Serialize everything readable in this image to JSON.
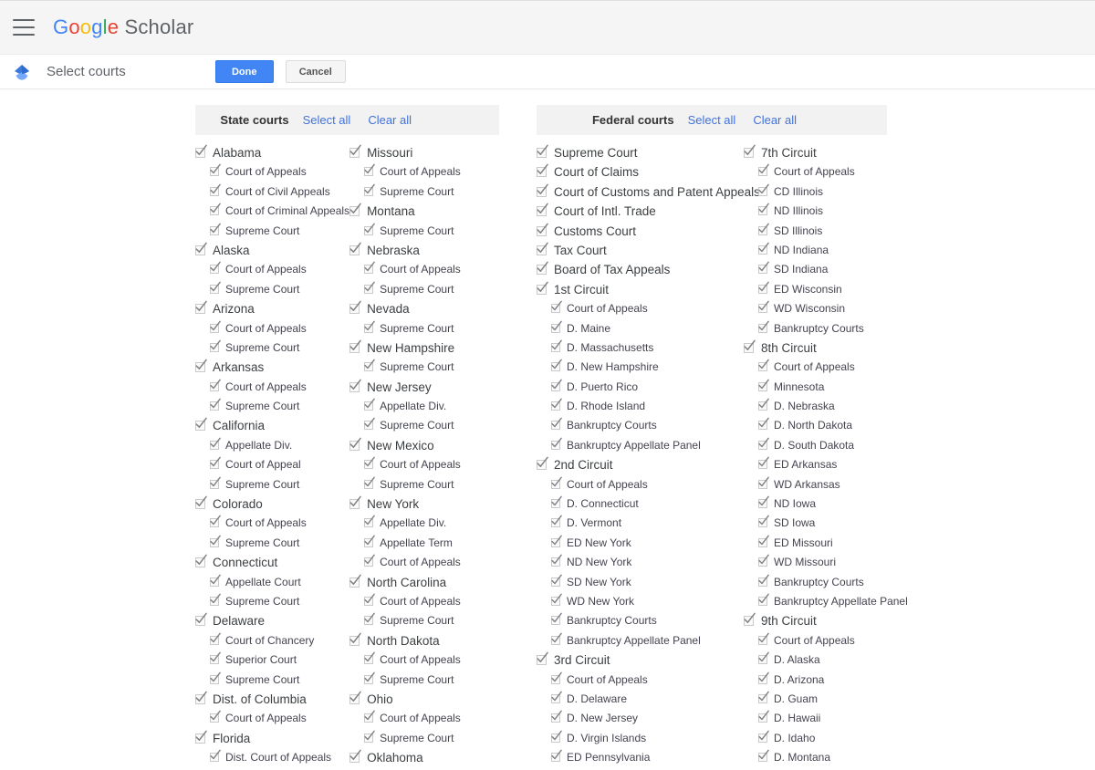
{
  "appbar": {
    "menu_icon": "hamburger-menu-icon",
    "brand_letters": [
      "G",
      "o",
      "o",
      "g",
      "l",
      "e"
    ],
    "brand_word": "Scholar"
  },
  "actionbar": {
    "logo_icon": "scholar-diamond-icon",
    "page_title": "Select courts",
    "done_label": "Done",
    "cancel_label": "Cancel"
  },
  "colors": {
    "accent_blue": "#4285f4",
    "link_blue": "#4272db",
    "panel_header_bg": "#f2f2f2",
    "appbar_bg": "#f5f5f5",
    "text": "#3c4043"
  },
  "panels": [
    {
      "id": "state-courts",
      "title": "State courts",
      "select_all": "Select all",
      "clear_all": "Clear all",
      "columns": [
        [
          {
            "label": "Alabama",
            "checked": true,
            "level": 0
          },
          {
            "label": "Court of Appeals",
            "checked": true,
            "level": 1
          },
          {
            "label": "Court of Civil Appeals",
            "checked": true,
            "level": 1
          },
          {
            "label": "Court of Criminal Appeals",
            "checked": true,
            "level": 1
          },
          {
            "label": "Supreme Court",
            "checked": true,
            "level": 1
          },
          {
            "label": "Alaska",
            "checked": true,
            "level": 0
          },
          {
            "label": "Court of Appeals",
            "checked": true,
            "level": 1
          },
          {
            "label": "Supreme Court",
            "checked": true,
            "level": 1
          },
          {
            "label": "Arizona",
            "checked": true,
            "level": 0
          },
          {
            "label": "Court of Appeals",
            "checked": true,
            "level": 1
          },
          {
            "label": "Supreme Court",
            "checked": true,
            "level": 1
          },
          {
            "label": "Arkansas",
            "checked": true,
            "level": 0
          },
          {
            "label": "Court of Appeals",
            "checked": true,
            "level": 1
          },
          {
            "label": "Supreme Court",
            "checked": true,
            "level": 1
          },
          {
            "label": "California",
            "checked": true,
            "level": 0
          },
          {
            "label": "Appellate Div.",
            "checked": true,
            "level": 1
          },
          {
            "label": "Court of Appeal",
            "checked": true,
            "level": 1
          },
          {
            "label": "Supreme Court",
            "checked": true,
            "level": 1
          },
          {
            "label": "Colorado",
            "checked": true,
            "level": 0
          },
          {
            "label": "Court of Appeals",
            "checked": true,
            "level": 1
          },
          {
            "label": "Supreme Court",
            "checked": true,
            "level": 1
          },
          {
            "label": "Connecticut",
            "checked": true,
            "level": 0
          },
          {
            "label": "Appellate Court",
            "checked": true,
            "level": 1
          },
          {
            "label": "Supreme Court",
            "checked": true,
            "level": 1
          },
          {
            "label": "Delaware",
            "checked": true,
            "level": 0
          },
          {
            "label": "Court of Chancery",
            "checked": true,
            "level": 1
          },
          {
            "label": "Superior Court",
            "checked": true,
            "level": 1
          },
          {
            "label": "Supreme Court",
            "checked": true,
            "level": 1
          },
          {
            "label": "Dist. of Columbia",
            "checked": true,
            "level": 0
          },
          {
            "label": "Court of Appeals",
            "checked": true,
            "level": 1
          },
          {
            "label": "Florida",
            "checked": true,
            "level": 0
          },
          {
            "label": "Dist. Court of Appeals",
            "checked": true,
            "level": 1
          }
        ],
        [
          {
            "label": "Missouri",
            "checked": true,
            "level": 0
          },
          {
            "label": "Court of Appeals",
            "checked": true,
            "level": 1
          },
          {
            "label": "Supreme Court",
            "checked": true,
            "level": 1
          },
          {
            "label": "Montana",
            "checked": true,
            "level": 0
          },
          {
            "label": "Supreme Court",
            "checked": true,
            "level": 1
          },
          {
            "label": "Nebraska",
            "checked": true,
            "level": 0
          },
          {
            "label": "Court of Appeals",
            "checked": true,
            "level": 1
          },
          {
            "label": "Supreme Court",
            "checked": true,
            "level": 1
          },
          {
            "label": "Nevada",
            "checked": true,
            "level": 0
          },
          {
            "label": "Supreme Court",
            "checked": true,
            "level": 1
          },
          {
            "label": "New Hampshire",
            "checked": true,
            "level": 0
          },
          {
            "label": "Supreme Court",
            "checked": true,
            "level": 1
          },
          {
            "label": "New Jersey",
            "checked": true,
            "level": 0
          },
          {
            "label": "Appellate Div.",
            "checked": true,
            "level": 1
          },
          {
            "label": "Supreme Court",
            "checked": true,
            "level": 1
          },
          {
            "label": "New Mexico",
            "checked": true,
            "level": 0
          },
          {
            "label": "Court of Appeals",
            "checked": true,
            "level": 1
          },
          {
            "label": "Supreme Court",
            "checked": true,
            "level": 1
          },
          {
            "label": "New York",
            "checked": true,
            "level": 0
          },
          {
            "label": "Appellate Div.",
            "checked": true,
            "level": 1
          },
          {
            "label": "Appellate Term",
            "checked": true,
            "level": 1
          },
          {
            "label": "Court of Appeals",
            "checked": true,
            "level": 1
          },
          {
            "label": "North Carolina",
            "checked": true,
            "level": 0
          },
          {
            "label": "Court of Appeals",
            "checked": true,
            "level": 1
          },
          {
            "label": "Supreme Court",
            "checked": true,
            "level": 1
          },
          {
            "label": "North Dakota",
            "checked": true,
            "level": 0
          },
          {
            "label": "Court of Appeals",
            "checked": true,
            "level": 1
          },
          {
            "label": "Supreme Court",
            "checked": true,
            "level": 1
          },
          {
            "label": "Ohio",
            "checked": true,
            "level": 0
          },
          {
            "label": "Court of Appeals",
            "checked": true,
            "level": 1
          },
          {
            "label": "Supreme Court",
            "checked": true,
            "level": 1
          },
          {
            "label": "Oklahoma",
            "checked": true,
            "level": 0
          }
        ]
      ]
    },
    {
      "id": "federal-courts",
      "title": "Federal courts",
      "select_all": "Select all",
      "clear_all": "Clear all",
      "columns": [
        [
          {
            "label": "Supreme Court",
            "checked": true,
            "level": 0
          },
          {
            "label": "Court of Claims",
            "checked": true,
            "level": 0
          },
          {
            "label": "Court of Customs and Patent Appeals",
            "checked": true,
            "level": 0
          },
          {
            "label": "Court of Intl. Trade",
            "checked": true,
            "level": 0
          },
          {
            "label": "Customs Court",
            "checked": true,
            "level": 0
          },
          {
            "label": "Tax Court",
            "checked": true,
            "level": 0
          },
          {
            "label": "Board of Tax Appeals",
            "checked": true,
            "level": 0
          },
          {
            "label": "1st Circuit",
            "checked": true,
            "level": 0
          },
          {
            "label": "Court of Appeals",
            "checked": true,
            "level": 1
          },
          {
            "label": "D. Maine",
            "checked": true,
            "level": 1
          },
          {
            "label": "D. Massachusetts",
            "checked": true,
            "level": 1
          },
          {
            "label": "D. New Hampshire",
            "checked": true,
            "level": 1
          },
          {
            "label": "D. Puerto Rico",
            "checked": true,
            "level": 1
          },
          {
            "label": "D. Rhode Island",
            "checked": true,
            "level": 1
          },
          {
            "label": "Bankruptcy Courts",
            "checked": true,
            "level": 1
          },
          {
            "label": "Bankruptcy Appellate Panel",
            "checked": true,
            "level": 1
          },
          {
            "label": "2nd Circuit",
            "checked": true,
            "level": 0
          },
          {
            "label": "Court of Appeals",
            "checked": true,
            "level": 1
          },
          {
            "label": "D. Connecticut",
            "checked": true,
            "level": 1
          },
          {
            "label": "D. Vermont",
            "checked": true,
            "level": 1
          },
          {
            "label": "ED New York",
            "checked": true,
            "level": 1
          },
          {
            "label": "ND New York",
            "checked": true,
            "level": 1
          },
          {
            "label": "SD New York",
            "checked": true,
            "level": 1
          },
          {
            "label": "WD New York",
            "checked": true,
            "level": 1
          },
          {
            "label": "Bankruptcy Courts",
            "checked": true,
            "level": 1
          },
          {
            "label": "Bankruptcy Appellate Panel",
            "checked": true,
            "level": 1
          },
          {
            "label": "3rd Circuit",
            "checked": true,
            "level": 0
          },
          {
            "label": "Court of Appeals",
            "checked": true,
            "level": 1
          },
          {
            "label": "D. Delaware",
            "checked": true,
            "level": 1
          },
          {
            "label": "D. New Jersey",
            "checked": true,
            "level": 1
          },
          {
            "label": "D. Virgin Islands",
            "checked": true,
            "level": 1
          },
          {
            "label": "ED Pennsylvania",
            "checked": true,
            "level": 1
          }
        ],
        [
          {
            "label": "7th Circuit",
            "checked": true,
            "level": 0
          },
          {
            "label": "Court of Appeals",
            "checked": true,
            "level": 1
          },
          {
            "label": "CD Illinois",
            "checked": true,
            "level": 1
          },
          {
            "label": "ND Illinois",
            "checked": true,
            "level": 1
          },
          {
            "label": "SD Illinois",
            "checked": true,
            "level": 1
          },
          {
            "label": "ND Indiana",
            "checked": true,
            "level": 1
          },
          {
            "label": "SD Indiana",
            "checked": true,
            "level": 1
          },
          {
            "label": "ED Wisconsin",
            "checked": true,
            "level": 1
          },
          {
            "label": "WD Wisconsin",
            "checked": true,
            "level": 1
          },
          {
            "label": "Bankruptcy Courts",
            "checked": true,
            "level": 1
          },
          {
            "label": "8th Circuit",
            "checked": true,
            "level": 0
          },
          {
            "label": "Court of Appeals",
            "checked": true,
            "level": 1
          },
          {
            "label": "Minnesota",
            "checked": true,
            "level": 1
          },
          {
            "label": "D. Nebraska",
            "checked": true,
            "level": 1
          },
          {
            "label": "D. North Dakota",
            "checked": true,
            "level": 1
          },
          {
            "label": "D. South Dakota",
            "checked": true,
            "level": 1
          },
          {
            "label": "ED Arkansas",
            "checked": true,
            "level": 1
          },
          {
            "label": "WD Arkansas",
            "checked": true,
            "level": 1
          },
          {
            "label": "ND Iowa",
            "checked": true,
            "level": 1
          },
          {
            "label": "SD Iowa",
            "checked": true,
            "level": 1
          },
          {
            "label": "ED Missouri",
            "checked": true,
            "level": 1
          },
          {
            "label": "WD Missouri",
            "checked": true,
            "level": 1
          },
          {
            "label": "Bankruptcy Courts",
            "checked": true,
            "level": 1
          },
          {
            "label": "Bankruptcy Appellate Panel",
            "checked": true,
            "level": 1
          },
          {
            "label": "9th Circuit",
            "checked": true,
            "level": 0
          },
          {
            "label": "Court of Appeals",
            "checked": true,
            "level": 1
          },
          {
            "label": "D. Alaska",
            "checked": true,
            "level": 1
          },
          {
            "label": "D. Arizona",
            "checked": true,
            "level": 1
          },
          {
            "label": "D. Guam",
            "checked": true,
            "level": 1
          },
          {
            "label": "D. Hawaii",
            "checked": true,
            "level": 1
          },
          {
            "label": "D. Idaho",
            "checked": true,
            "level": 1
          },
          {
            "label": "D. Montana",
            "checked": true,
            "level": 1
          }
        ]
      ]
    }
  ]
}
